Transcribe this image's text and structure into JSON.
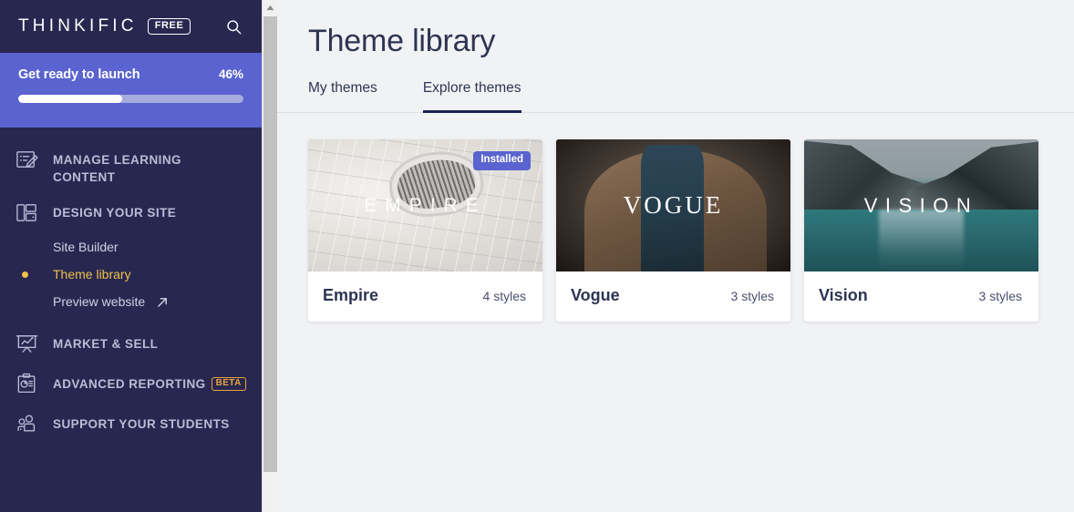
{
  "sidebar": {
    "logo": "THINKIFIC",
    "plan_badge": "FREE",
    "search_icon": "search-icon",
    "launch": {
      "title": "Get ready to launch",
      "percent_label": "46%",
      "percent_value": 46,
      "track_color": "#a6adde",
      "fill_color": "#ffffff",
      "panel_color": "#5a63cf"
    },
    "background_color": "#272750",
    "sections": [
      {
        "label": "MANAGE LEARNING CONTENT",
        "icon": "edit-document-icon",
        "badge": null
      },
      {
        "label": "DESIGN YOUR SITE",
        "icon": "layout-panels-icon",
        "badge": null
      },
      {
        "label": "MARKET & SELL",
        "icon": "presentation-chart-icon",
        "badge": null
      },
      {
        "label": "ADVANCED REPORTING",
        "icon": "clipboard-report-icon",
        "badge": "BETA"
      },
      {
        "label": "SUPPORT YOUR STUDENTS",
        "icon": "users-group-icon",
        "badge": null
      }
    ],
    "design_subitems": [
      {
        "label": "Site Builder",
        "active": false,
        "external": false
      },
      {
        "label": "Theme library",
        "active": true,
        "external": false
      },
      {
        "label": "Preview website",
        "active": false,
        "external": true
      }
    ],
    "active_color": "#f1c04a",
    "beta_badge_color": "#e8a33d"
  },
  "main": {
    "page_title": "Theme library",
    "tabs": [
      {
        "label": "My themes",
        "active": false
      },
      {
        "label": "Explore themes",
        "active": true
      }
    ],
    "active_tab_underline_color": "#1d2254",
    "cards": [
      {
        "name": "Empire",
        "styles": "4 styles",
        "thumb_word": "EMPIRE",
        "badge": "Installed",
        "badge_color": "#5a63cf"
      },
      {
        "name": "Vogue",
        "styles": "3 styles",
        "thumb_word": "VOGUE",
        "badge": null,
        "badge_color": null
      },
      {
        "name": "Vision",
        "styles": "3 styles",
        "thumb_word": "VISION",
        "badge": null,
        "badge_color": null
      }
    ]
  },
  "scrollbar": {
    "up_arrow_icon": "triangle-up-icon",
    "thumb_color": "#c1c1c1"
  }
}
